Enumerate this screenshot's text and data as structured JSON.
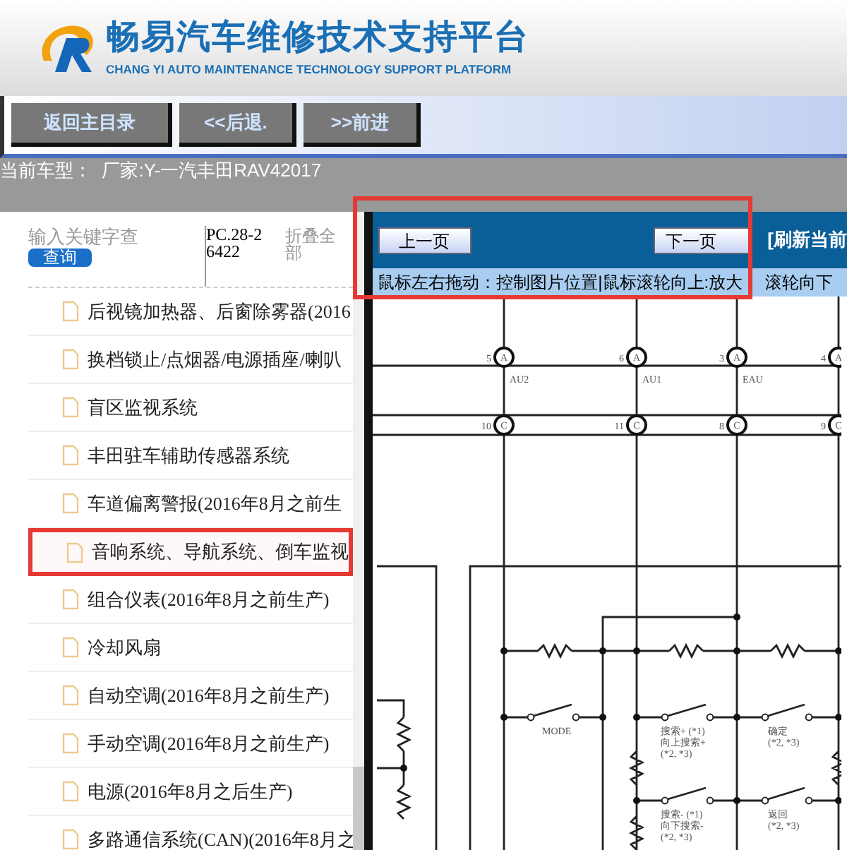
{
  "header": {
    "title": "畅易汽车维修技术支持平台",
    "subtitle": "CHANG YI AUTO MAINTENANCE TECHNOLOGY SUPPORT PLATFORM"
  },
  "toolbar": {
    "buttons": [
      "返回主目录",
      "<<后退.",
      ">>前进"
    ]
  },
  "current_model": "当前车型：  厂家:Y-一汽丰田RAV42017",
  "sidebar": {
    "search": {
      "placeholder": "输入关键字查",
      "button": "查询"
    },
    "code": "PC.28-26422",
    "collapse_all": "折叠全部",
    "items": [
      {
        "label": "后视镜加热器、后窗除雾器(2016",
        "highlighted": false
      },
      {
        "label": "换档锁止/点烟器/电源插座/喇叭",
        "highlighted": false
      },
      {
        "label": "盲区监视系统",
        "highlighted": false
      },
      {
        "label": "丰田驻车辅助传感器系统",
        "highlighted": false
      },
      {
        "label": "车道偏离警报(2016年8月之前生",
        "highlighted": false
      },
      {
        "label": "音响系统、导航系统、倒车监视",
        "highlighted": true
      },
      {
        "label": "组合仪表(2016年8月之前生产)",
        "highlighted": false
      },
      {
        "label": "冷却风扇",
        "highlighted": false
      },
      {
        "label": "自动空调(2016年8月之前生产)",
        "highlighted": false
      },
      {
        "label": "手动空调(2016年8月之前生产)",
        "highlighted": false
      },
      {
        "label": "电源(2016年8月之后生产)",
        "highlighted": false
      },
      {
        "label": "多路通信系统(CAN)(2016年8月之",
        "highlighted": false
      }
    ]
  },
  "viewer": {
    "prev_button": "上一页",
    "next_button": "下一页",
    "refresh": "[刷新当前",
    "highlighted": true,
    "hint": [
      "鼠标左右拖动：控制图片位置|鼠标滚轮向上:放大",
      "滚轮向下"
    ],
    "diagram": {
      "connectors_a": [
        {
          "pin": "5",
          "letter": "A",
          "label": "AU2"
        },
        {
          "pin": "6",
          "letter": "A",
          "label": "AU1"
        },
        {
          "pin": "3",
          "letter": "A",
          "label": "EAU"
        },
        {
          "pin": "4",
          "letter": "A"
        }
      ],
      "connectors_c": [
        {
          "pin": "10",
          "letter": "C"
        },
        {
          "pin": "11",
          "letter": "C"
        },
        {
          "pin": "8",
          "letter": "C"
        },
        {
          "pin": "9",
          "letter": "C"
        }
      ],
      "switches": [
        {
          "lines": [
            "MODE"
          ]
        },
        {
          "lines": [
            "搜索+ (*1)",
            "向上搜索+",
            "(*2, *3)"
          ]
        },
        {
          "lines": [
            "确定",
            "(*2, *3)"
          ]
        },
        {
          "lines": [
            "搜索- (*1)",
            "向下搜索-",
            "(*2, *3)"
          ]
        },
        {
          "lines": [
            "返回",
            "(*2, *3)"
          ]
        }
      ]
    }
  }
}
